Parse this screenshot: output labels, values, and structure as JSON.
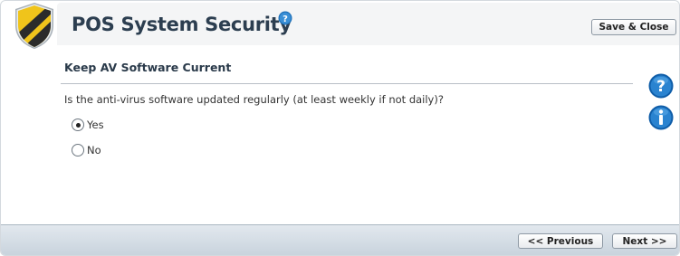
{
  "header": {
    "title": "POS System Security",
    "save_close_label": "Save & Close"
  },
  "section": {
    "title": "Keep AV Software Current"
  },
  "question": {
    "text": "Is the anti-virus software updated regularly (at least weekly if not daily)?",
    "options": [
      {
        "label": "Yes",
        "selected": true
      },
      {
        "label": "No",
        "selected": false
      }
    ]
  },
  "footer": {
    "previous_label": "<< Previous",
    "next_label": "Next >>"
  },
  "icons": {
    "shield": "shield-icon",
    "help": "help-icon",
    "info": "info-icon"
  },
  "colors": {
    "shield_yellow": "#f0c41b",
    "shield_dark": "#2b2b2b",
    "accent_blue": "#1d6fb8"
  }
}
